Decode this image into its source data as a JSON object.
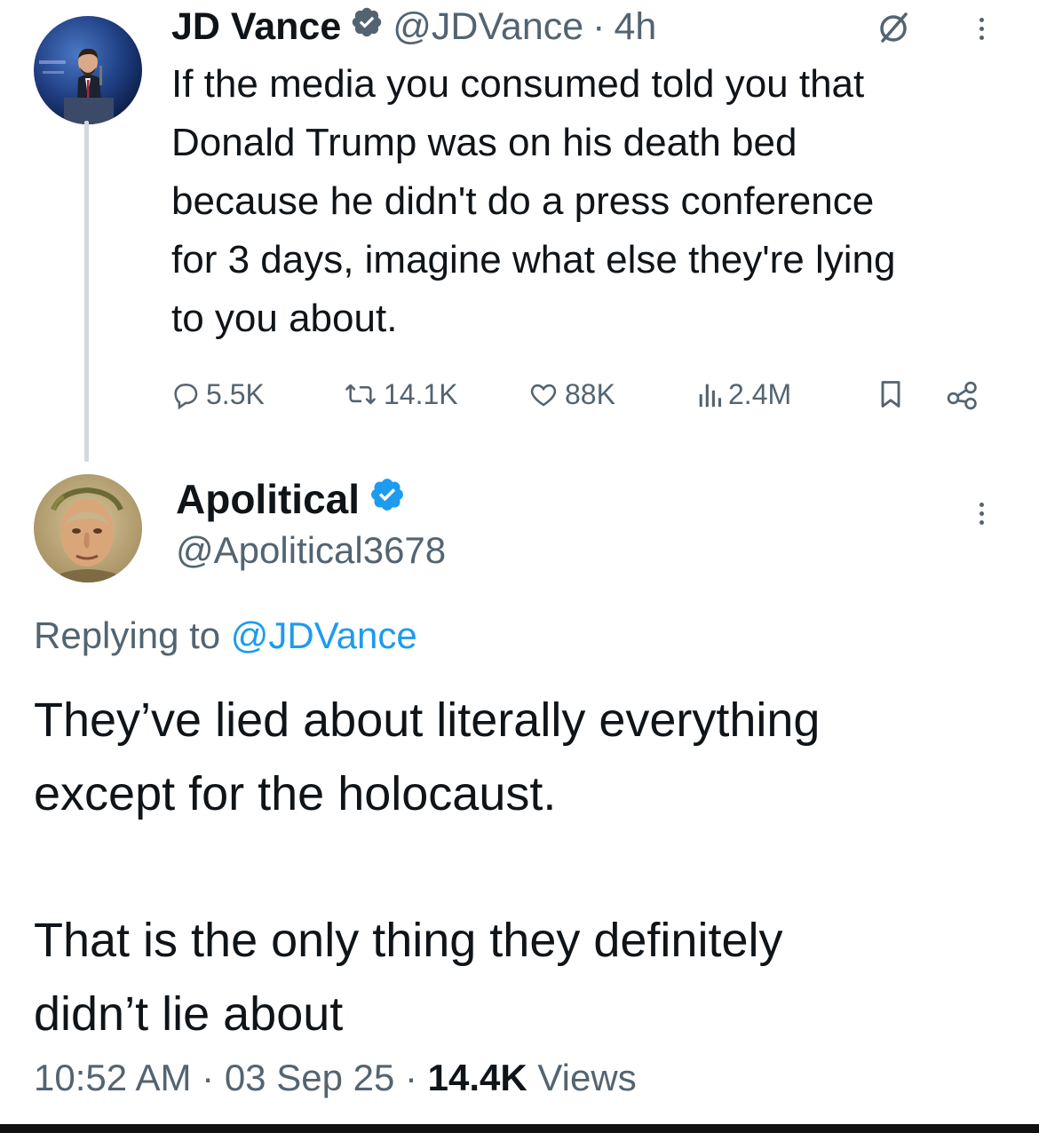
{
  "tweet": {
    "author_name": "JD Vance",
    "author_handle": "@JDVance",
    "separator": "·",
    "time_ago": "4h",
    "text": "If the media you consumed told you that\nDonald Trump was on his death bed\nbecause he didn't do a press conference\nfor 3 days, imagine what else they're lying\nto you about.",
    "replies": "5.5K",
    "reposts": "14.1K",
    "likes": "88K",
    "views": "2.4M"
  },
  "reply": {
    "author_name": "Apolitical",
    "author_handle": "@Apolitical3678",
    "replying_to_label": "Replying to",
    "replying_to_handle": "@JDVance",
    "paragraph_1": "They’ve lied about literally everything\nexcept for the holocaust.",
    "paragraph_2": "That is the only thing they definitely\ndidn’t lie about",
    "time": "10:52 AM",
    "separator": "·",
    "date": "03 Sep 25",
    "views_count": "14.4K",
    "views_label": "Views"
  },
  "colors": {
    "text_primary": "#0f1419",
    "text_secondary": "#536471",
    "verified_badge": "#1d9bf0",
    "mention": "#1d9bf0",
    "thread_line": "#cfd9de"
  },
  "icons": {
    "verified_badge_1": "verified-badge-icon",
    "grok": "grok-icon",
    "more_1": "more-vertical-icon",
    "reply": "reply-icon",
    "repost": "repost-icon",
    "like": "heart-icon",
    "views": "views-bar-chart-icon",
    "bookmark": "bookmark-icon",
    "share": "share-icon",
    "verified_badge_2": "verified-badge-icon",
    "more_2": "more-vertical-icon"
  }
}
